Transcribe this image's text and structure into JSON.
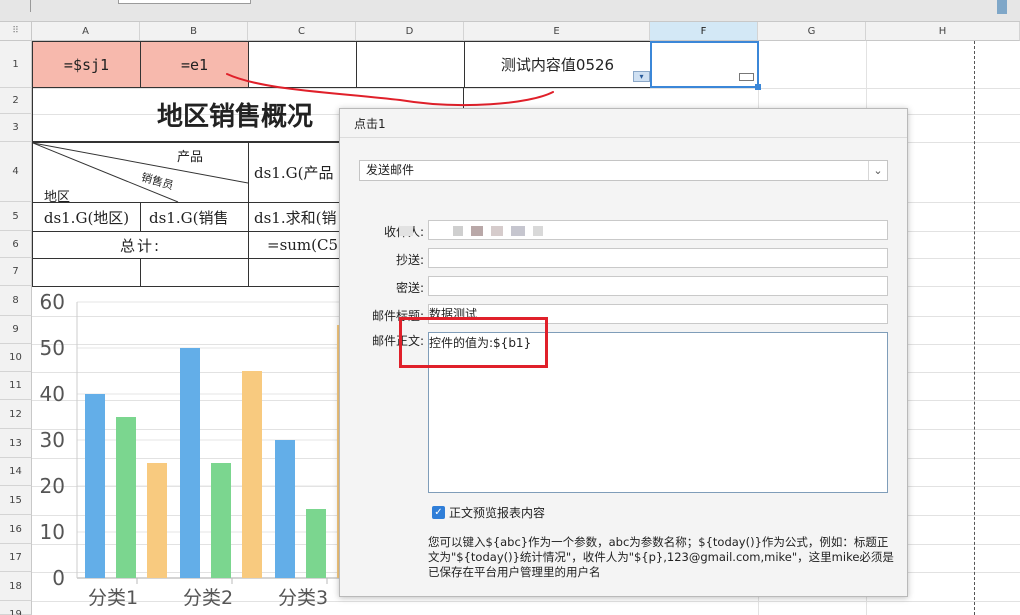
{
  "sheet": {
    "columns": [
      "A",
      "B",
      "C",
      "D",
      "E",
      "F",
      "G",
      "H"
    ],
    "rows": [
      "1",
      "2",
      "3",
      "4",
      "5",
      "6",
      "7",
      "8",
      "9",
      "10",
      "11",
      "12",
      "13",
      "14",
      "15",
      "16",
      "17",
      "18",
      "19"
    ],
    "corner_glyph": "⠿"
  },
  "cells": {
    "a1": "=$sj1",
    "b1": "=e1",
    "e1": "测试内容值0526",
    "title": "地区销售概况",
    "header_product": "产品",
    "header_salesman": "销售员",
    "header_region": "地区",
    "d4": "ds1.G(产品",
    "a5": "ds1.G(地区)",
    "b5": "ds1.G(销售",
    "d5": "ds1.求和(销",
    "total_label": "总计:",
    "total_formula": "=sum(C5)"
  },
  "chart_data": {
    "type": "bar",
    "categories": [
      "分类1",
      "分类2",
      "分类3"
    ],
    "series": [
      {
        "color": "#63aee8",
        "values": [
          40,
          50,
          30
        ]
      },
      {
        "color": "#7bd68f",
        "values": [
          35,
          25,
          15
        ]
      },
      {
        "color": "#f8ca7f",
        "values": [
          25,
          45,
          55
        ]
      }
    ],
    "y_ticks": [
      "60",
      "50",
      "40",
      "30",
      "20",
      "10",
      "0"
    ],
    "ylim": [
      0,
      60
    ]
  },
  "dialog": {
    "title": "点击1",
    "action": "发送邮件",
    "fields": {
      "to_label": "收件人:",
      "cc_label": "抄送:",
      "bcc_label": "密送:",
      "subject_label": "邮件标题:",
      "subject_value": "数据测试",
      "body_label": "邮件正文:",
      "body_value": "控件的值为:${b1}"
    },
    "preview_checkbox_label": "正文预览报表内容",
    "preview_checked": true,
    "hint": "您可以键入${abc}作为一个参数，abc为参数名称；${today()}作为公式，例如：标题正文为\"${today()}统计情况\"，收件人为\"${p},123@gmail.com,mike\"，这里mike必须是已保存在平台用户管理里的用户名"
  },
  "colors": {
    "pink_cell": "#f7b9ad",
    "selection": "#3b87d8",
    "annotation_red": "#e0202a"
  }
}
